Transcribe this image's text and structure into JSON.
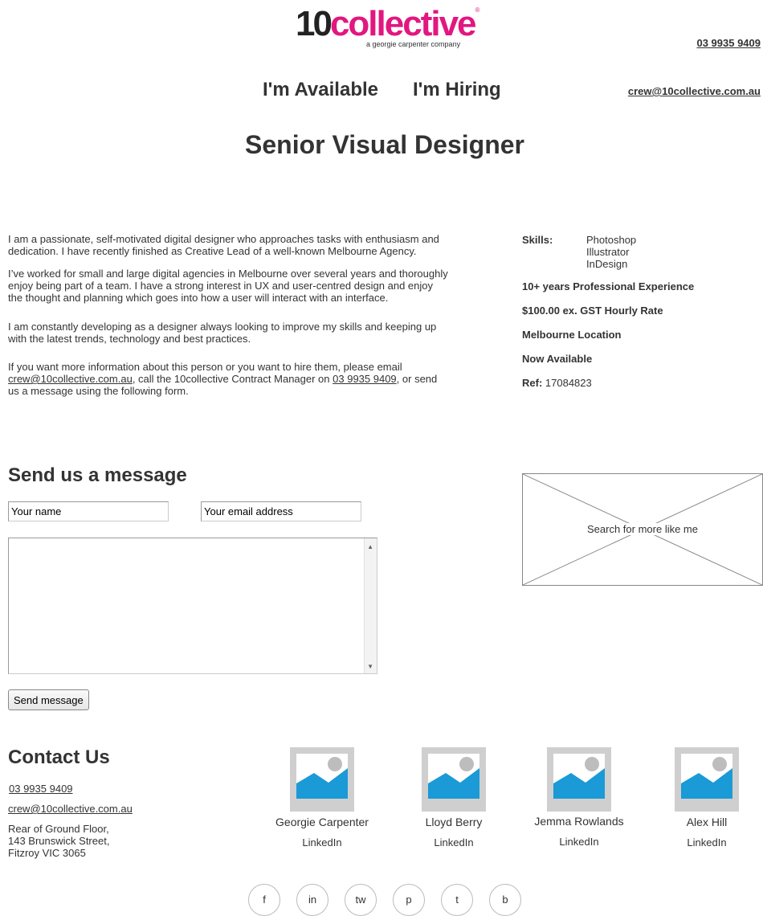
{
  "header": {
    "logo_main": "10",
    "logo_brand": "collective",
    "logo_reg": "®",
    "logo_tagline": "a georgie carpenter company",
    "phone": "03 9935 9409",
    "email": "crew@10collective.com.au",
    "nav": [
      "I'm Available",
      "I'm Hiring"
    ]
  },
  "page_title": "Senior Visual Designer",
  "bio": {
    "p1": "I am a passionate, self-motivated digital designer who approaches tasks with enthusiasm and dedication. I have recently finished as Creative Lead of a well-known Melbourne Agency.",
    "p2": "I’ve worked for small and large digital agencies in Melbourne over several years and thoroughly enjoy being part of a team. I have a strong interest in UX and user-centred design and enjoy the thought and planning which goes into how a user will interact with an interface.",
    "p3": "I am constantly developing as a designer always looking to improve my skills and keeping up with the latest trends, technology and best practices.",
    "p4_a": "If you want more information about this person or you want to hire them, please email",
    "p4_email": "crew@10collective.com.au",
    "p4_b": ", call the 10collective Contract Manager on",
    "p4_phone": "03 9935 9409",
    "p4_c": ", or send us a message using the following form."
  },
  "details": {
    "skills_label": "Skills:",
    "skills": [
      "Photoshop",
      "Illustrator",
      "InDesign"
    ],
    "experience": "10+ years Professional Experience",
    "rate": "$100.00 ex. GST Hourly Rate",
    "location": "Melbourne Location",
    "availability": "Now Available",
    "ref_label": "Ref:",
    "ref_value": "17084823"
  },
  "form": {
    "title": "Send us a message",
    "name_value": "Your name",
    "email_value": "Your email address",
    "message_value": "",
    "send_label": "Send message"
  },
  "search_box": {
    "label": "Search for more like me"
  },
  "contact": {
    "title": "Contact Us",
    "phone": "03 9935 9409",
    "email": "crew@10collective.com.au",
    "address": [
      "Rear of Ground Floor,",
      "143 Brunswick Street,",
      "Fitzroy VIC 3065"
    ]
  },
  "team": [
    {
      "name": "Georgie Carpenter",
      "link": "LinkedIn"
    },
    {
      "name": "Lloyd Berry",
      "link": "LinkedIn"
    },
    {
      "name": "Jemma Rowlands",
      "link": "LinkedIn"
    },
    {
      "name": "Alex Hill",
      "link": "LinkedIn"
    }
  ],
  "social": [
    "f",
    "in",
    "tw",
    "p",
    "t",
    "b"
  ],
  "colors": {
    "brand_pink": "#e2177f",
    "text": "#333333",
    "placeholder_image_blue": "#1a9ad6",
    "placeholder_image_gray": "#cfcfcf"
  }
}
